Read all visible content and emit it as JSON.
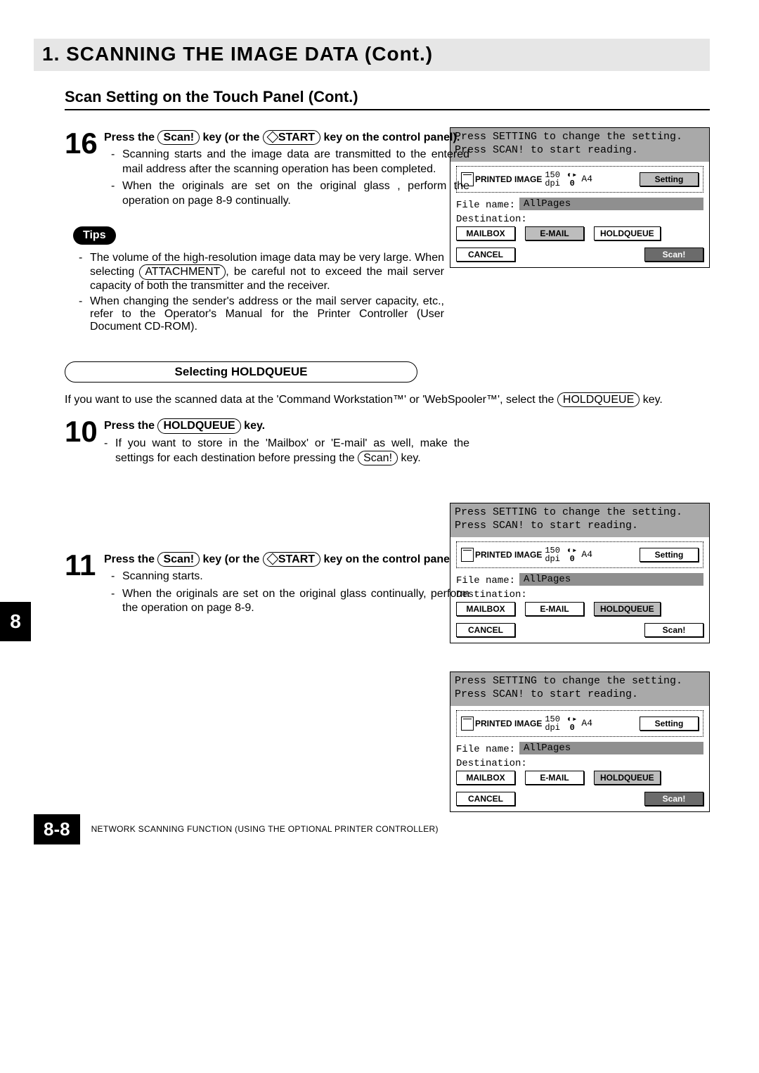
{
  "chapter_tab": "8",
  "chapter_title": "1. SCANNING THE IMAGE DATA (Cont.)",
  "subheading": "Scan Setting on the Touch Panel (Cont.)",
  "step16": {
    "num": "16",
    "title_pre": "Press the ",
    "key1": "Scan!",
    "title_mid": " key (or the ",
    "key2": "START",
    "title_post": " key on the control panel).",
    "bullets": [
      "Scanning starts and the image data are transmitted to the entered mail address after the scanning operation has been completed.",
      "When the originals are set on the original glass , perform the operation on page 8-9 continually."
    ]
  },
  "tips_label": "Tips",
  "tips_bullets": [
    {
      "pre": "The volume of the high-resolution image data may be very large.  When selecting",
      "key": "ATTACHMENT",
      "post": ", be careful not to exceed the mail server capacity of both the transmitter and the receiver."
    },
    {
      "text": "When changing the sender's address or the mail server capacity, etc., refer to the Operator's Manual for the Printer Controller (User Document CD-ROM)."
    }
  ],
  "holdqueue_heading": "Selecting HOLDQUEUE",
  "holdqueue_intro_pre": "If you want to use the scanned data at the 'Command Workstation™' or 'WebSpooler™', select the ",
  "holdqueue_intro_key": "HOLDQUEUE",
  "holdqueue_intro_post": " key.",
  "step10": {
    "num": "10",
    "title_pre": "Press the ",
    "key": "HOLDQUEUE",
    "title_post": " key.",
    "bullet_pre": "If you want to store in the 'Mailbox' or 'E-mail' as well, make the settings for each destination before pressing the ",
    "bullet_key": "Scan!",
    "bullet_post": " key."
  },
  "step11": {
    "num": "11",
    "title_pre": "Press the ",
    "key1": "Scan!",
    "title_mid": " key (or the ",
    "key2": "START",
    "title_post": " key on the control panel).",
    "bullets": [
      "Scanning starts.",
      "When the originals are set on the original glass continually, perform the operation on page 8-9."
    ]
  },
  "panel": {
    "line1": "Press SETTING to change the setting.",
    "line2": "Press SCAN! to start reading.",
    "printed_label": "PRINTED IMAGE",
    "res_top": "150",
    "res_bot": "dpi",
    "exp": "0",
    "paper": "A4",
    "setting_btn": "Setting",
    "filename_label": "File name:",
    "filename_value": "AllPages",
    "destination_label": "Destination:",
    "mailbox_btn": "MAILBOX",
    "email_btn": "E-MAIL",
    "holdqueue_btn": "HOLDQUEUE",
    "cancel_btn": "CANCEL",
    "scan_btn": "Scan!"
  },
  "footer_page": "8-8",
  "footer_text": "NETWORK SCANNING FUNCTION (USING THE OPTIONAL PRINTER CONTROLLER)"
}
